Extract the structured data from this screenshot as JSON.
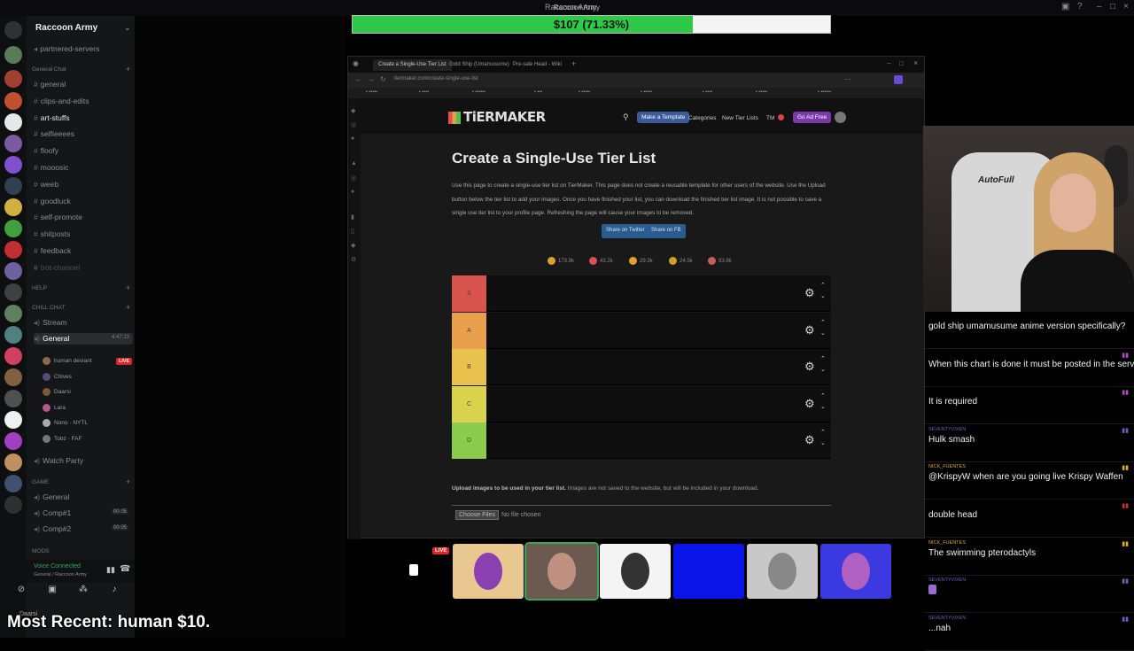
{
  "window": {
    "title": "Raccoon Army"
  },
  "discord": {
    "server_name": "Raccoon Army",
    "channels_top": [
      {
        "label": "partnered-servers",
        "style": "normal"
      }
    ],
    "category_general": "General Chat",
    "general_channels": [
      {
        "label": "general",
        "style": "normal"
      },
      {
        "label": "clips-and-edits",
        "style": "normal"
      },
      {
        "label": "art-stuffs",
        "style": "bright"
      },
      {
        "label": "selfieeees",
        "style": "normal"
      },
      {
        "label": "floofy",
        "style": "normal"
      },
      {
        "label": "mooosic",
        "style": "normal"
      },
      {
        "label": "weeb",
        "style": "normal"
      },
      {
        "label": "goodluck",
        "style": "normal"
      },
      {
        "label": "self-promote",
        "style": "normal"
      },
      {
        "label": "shitposts",
        "style": "normal"
      },
      {
        "label": "feedback",
        "style": "normal"
      },
      {
        "label": "bot-channel",
        "style": "dim"
      }
    ],
    "category_help": "HELP",
    "category_chill": "CHILL CHAT",
    "chill_channels": [
      {
        "label": "Stream"
      },
      {
        "label": "General",
        "time": "4:47:13",
        "active": true
      }
    ],
    "voice_users": [
      {
        "name": "human deviant",
        "live": true,
        "color": "#8a6a4a"
      },
      {
        "name": "Chives",
        "color": "#5a4a7a"
      },
      {
        "name": "Daarsi",
        "color": "#7a5a3a"
      },
      {
        "name": "Lara",
        "color": "#b05a8a"
      },
      {
        "name": "Nono · NYTL",
        "color": "#aaaaaa"
      },
      {
        "name": "Tobz · FAF",
        "color": "#777777"
      }
    ],
    "live_badge": "LIVE",
    "watch_party": "Watch Party",
    "category_game": "GAME",
    "game_channels": [
      {
        "label": "General"
      },
      {
        "label": "Comp#1",
        "count": "00 05"
      },
      {
        "label": "Comp#2",
        "count": "00 05"
      }
    ],
    "category_mods": "MODS",
    "voice_connected": "Voice Connected",
    "voice_connected_sub": "General / Raccoon Army",
    "footer_user": "Daarsi"
  },
  "goal": {
    "text": "$107 (71.33%)",
    "fraction": 0.7133,
    "fill_color": "#2fc94a"
  },
  "browser": {
    "url": "tiermaker.com/create-single-use-list",
    "tabs": [
      {
        "label": "Create a Single-Use Tier List",
        "active": true
      },
      {
        "label": "Gold Ship (Umamusume)"
      },
      {
        "label": "Pre-sale Head - Wiki"
      }
    ]
  },
  "tiermaker": {
    "logo": "TiERMAKER",
    "nav": {
      "make_template": "Make a Template",
      "categories": "Categories",
      "new_tier_lists": "New Tier Lists",
      "tm": "TM",
      "go_ad_free": "Go Ad Free"
    },
    "title": "Create a Single-Use Tier List",
    "description": "Use this page to create a single-use tier list on TierMaker. This page does not create a reusable template for other users of the website. Use the Upload button below the tier list to add your images. Once you have finished your list, you can download the finished tier list image. It is not possible to save a single use tier list to your profile page. Refreshing the page will cause your images to be removed.",
    "share_twitter": "Share on Twitter",
    "share_fb": "Share on FB",
    "reactions": [
      {
        "count": "173.9k",
        "color": "#e0a030"
      },
      {
        "count": "43.2k",
        "color": "#e05050"
      },
      {
        "count": "29.3k",
        "color": "#e0a030"
      },
      {
        "count": "24.5k",
        "color": "#d0a020"
      },
      {
        "count": "93.9k",
        "color": "#c06060"
      }
    ],
    "tiers": [
      {
        "label": "S",
        "color": "#d9534f"
      },
      {
        "label": "A",
        "color": "#e8a04c"
      },
      {
        "label": "B",
        "color": "#e8c24c"
      },
      {
        "label": "C",
        "color": "#d8d24c"
      },
      {
        "label": "D",
        "color": "#8ccc4c"
      }
    ],
    "upload_bold": "Upload images to be used in your tier list.",
    "upload_rest": " Images are not saved to the website, but will be included in your download.",
    "choose_file": "Choose Files",
    "no_file": "No file chosen"
  },
  "webcam": {
    "chair_brand": "AutoFull"
  },
  "chat": {
    "messages": [
      {
        "user": "",
        "text": "gold ship umamusume anime version specifically?",
        "color": "#a070d0"
      },
      {
        "user": "",
        "text": "When this chart is done it must be posted in the server",
        "color": "#b050c0"
      },
      {
        "user": "",
        "text": "It is required",
        "color": "#b050c0"
      },
      {
        "user": "SEVENTYVIXEN",
        "text": "Hulk smash",
        "color": "#7d5bbe"
      },
      {
        "user": "NICK_FUENTES",
        "text": "@KrispyW when are you going live Krispy Waffen",
        "color": "#e0b020"
      },
      {
        "user": "",
        "text": "double head",
        "color": "#d03030"
      },
      {
        "user": "NICK_FUENTES",
        "text": "The swimming pterodactyls",
        "color": "#e0b020"
      },
      {
        "user": "SEVENTYVIXEN",
        "text": "",
        "color": "#7d5bbe"
      },
      {
        "user": "SEVENTYVIXEN",
        "text": "...nah",
        "color": "#7d5bbe"
      }
    ]
  },
  "stream": {
    "live_label": "LIVE",
    "most_recent": "Most Recent: human $10."
  },
  "avatar_tiles": [
    {
      "bg": "#e8c890",
      "fg": "#8a40b0"
    },
    {
      "bg": "#6a5a50",
      "fg": "#c09080",
      "selected": true
    },
    {
      "bg": "#f4f4f4",
      "fg": "#333333"
    },
    {
      "bg": "#0a14e8",
      "fg": "#0a14e8"
    },
    {
      "bg": "#c8c8c8",
      "fg": "#888888"
    },
    {
      "bg": "#3a3ae0",
      "fg": "#b060c0"
    }
  ]
}
